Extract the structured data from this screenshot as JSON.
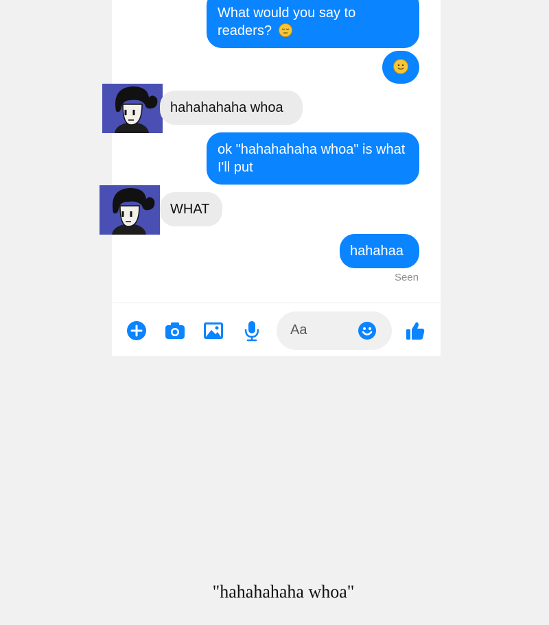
{
  "conversation": {
    "messages": [
      {
        "sender": "me",
        "text": "What would you say to readers?",
        "emoji": "pensive-face-emoji"
      },
      {
        "sender": "me",
        "emoji": "smiling-face-emoji"
      },
      {
        "sender": "other",
        "text": "hahahahaha whoa"
      },
      {
        "sender": "me",
        "text": "ok \"hahahahaha whoa\" is what I'll put"
      },
      {
        "sender": "other",
        "text": "WHAT"
      },
      {
        "sender": "me",
        "text": "hahahaa"
      }
    ],
    "status": "Seen"
  },
  "composer": {
    "placeholder": "Aa",
    "icons": [
      "plus-icon",
      "camera-icon",
      "image-icon",
      "microphone-icon",
      "emoji-icon",
      "thumbs-up-icon"
    ]
  },
  "caption": "\"hahahahaha whoa\"",
  "colors": {
    "accent": "#0a84ff",
    "incoming_bubble": "#ebebeb",
    "avatar_bg": "#4a4fb3",
    "page_bg": "#f1f1f1"
  }
}
